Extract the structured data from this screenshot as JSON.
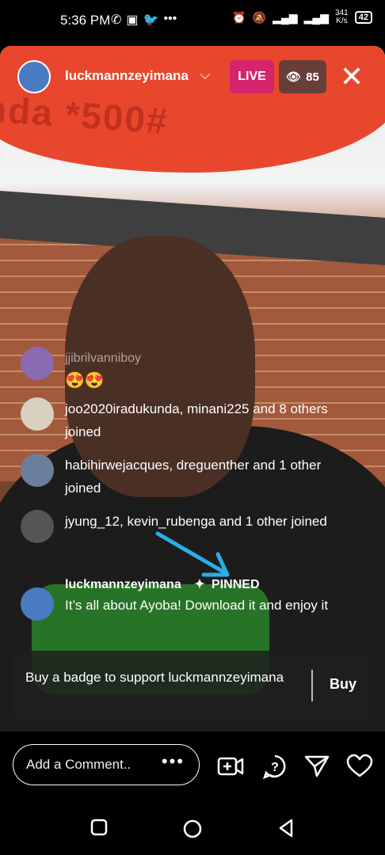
{
  "status_bar": {
    "time": "5:36 PM",
    "left_icons": [
      "whatsapp-icon",
      "app-icon",
      "twitter-icon",
      "more-dots"
    ],
    "right_icons": [
      "alarm-icon",
      "mute-icon",
      "signal-icon",
      "wifi-icon"
    ],
    "net_speed_value": "341",
    "net_speed_unit": "K/s",
    "battery": "42"
  },
  "header": {
    "host_name": "luckmannzeyimana",
    "live_label": "LIVE",
    "viewer_count": "85",
    "live_color": "#d6246e"
  },
  "video": {
    "umbrella_text": "nda *500#"
  },
  "feed": {
    "items": [
      {
        "name": "jjibrilvanniboy",
        "text": "😍😍"
      },
      {
        "text": "joo2020iradukunda, minani225 and 8 others joined"
      },
      {
        "text": "habihirwejacques, dreguenther and 1 other joined"
      },
      {
        "text": "jyung_12, kevin_rubenga and 1 other joined"
      }
    ]
  },
  "pinned": {
    "name": "luckmannzeyimana",
    "tag": "PINNED",
    "text": "It’s all about Ayoba! Download it and enjoy it"
  },
  "badge_card": {
    "text": "Buy a badge to support luckmannzeyimana",
    "buy_label": "Buy"
  },
  "bottom_bar": {
    "comment_placeholder": "Add a Comment..",
    "icons": [
      "more-options-icon",
      "add-video-guest-icon",
      "question-icon",
      "send-icon",
      "heart-icon"
    ]
  },
  "nav_bar": {
    "icons": [
      "recents-icon",
      "home-icon",
      "back-icon"
    ]
  }
}
